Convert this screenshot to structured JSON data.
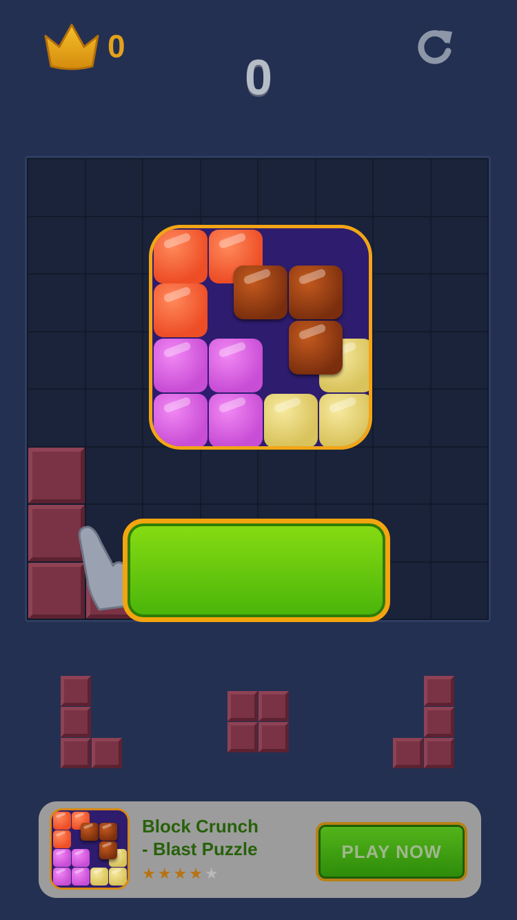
{
  "hud": {
    "best_score": "0",
    "score": "0",
    "icons": [
      "crown-icon",
      "restart-icon"
    ]
  },
  "board": {
    "rows": 8,
    "cols": 8,
    "filled_cells": [
      [
        5,
        0
      ],
      [
        6,
        0
      ],
      [
        7,
        0
      ],
      [
        7,
        1
      ]
    ]
  },
  "colors": {
    "background": "#233052",
    "block": "#7a3345",
    "accent_gold": "#f3a50f",
    "button_green": "#6cc80f"
  },
  "ad": {
    "title_line1": "Block Crunch",
    "title_line2": "- Blast Puzzle",
    "rating": 4,
    "rating_max": 5,
    "cta": "PLAY NOW"
  }
}
